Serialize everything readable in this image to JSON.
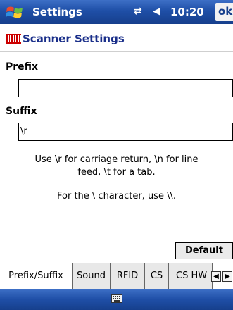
{
  "titlebar": {
    "app_name": "Settings",
    "status_connection": "⇄",
    "status_volume": "◀",
    "time": "10:20",
    "ok_label": "ok"
  },
  "header": {
    "title": "Scanner Settings"
  },
  "prefix": {
    "label": "Prefix",
    "value": ""
  },
  "suffix": {
    "label": "Suffix",
    "value": "\\r"
  },
  "help": {
    "line1": "Use \\r for carriage return, \\n for line",
    "line2": "feed, \\t for a tab.",
    "line3": "For the \\ character, use \\\\."
  },
  "default_button": "Default",
  "tabs": [
    {
      "label": "Prefix/Suffix",
      "active": true
    },
    {
      "label": "Sound",
      "active": false
    },
    {
      "label": "RFID",
      "active": false
    },
    {
      "label": "CS",
      "active": false
    },
    {
      "label": "CS HW",
      "active": false
    }
  ],
  "colors": {
    "titlebar": "#1f4fa7",
    "header_text": "#1a2f8a",
    "icon_red": "#cc0000"
  }
}
